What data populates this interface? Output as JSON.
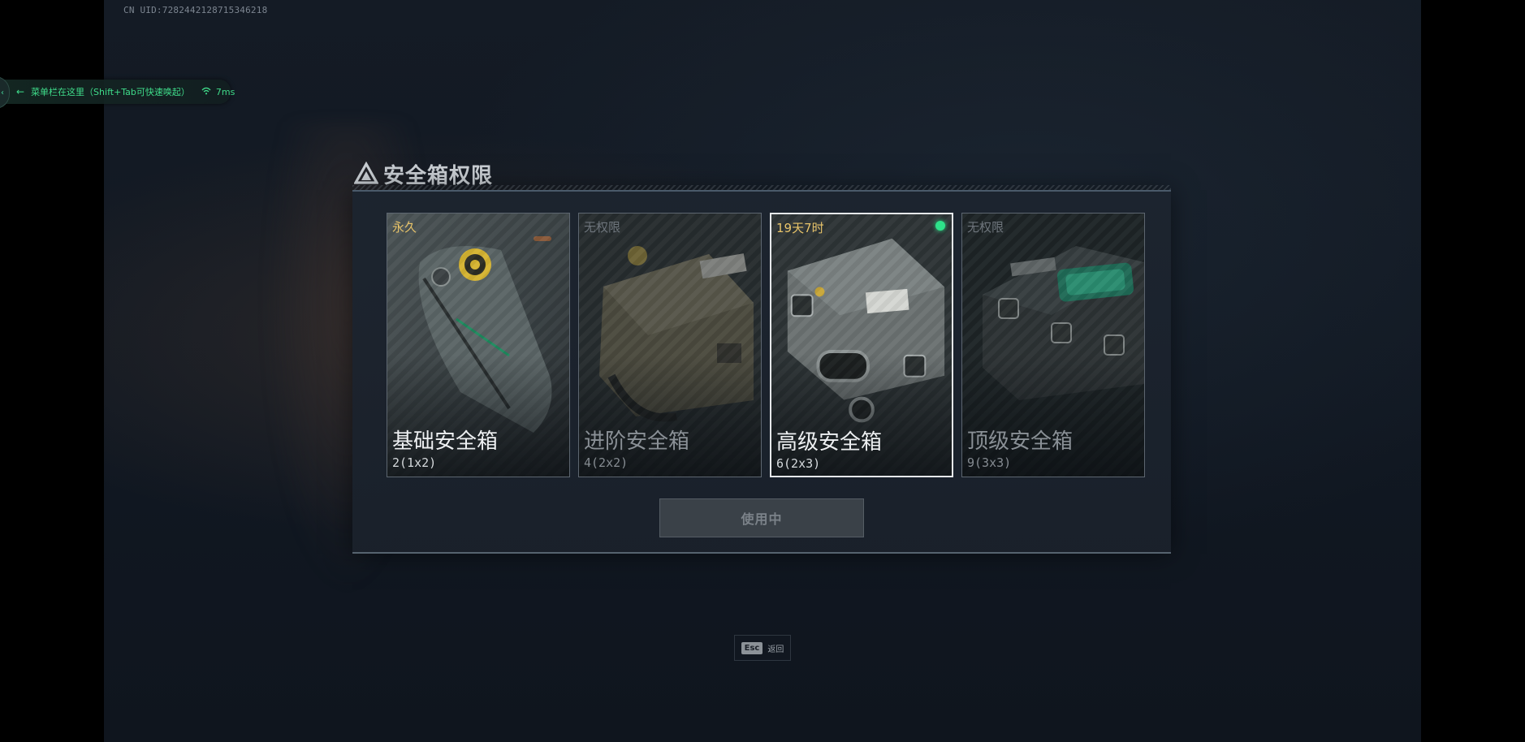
{
  "uid": "CN UID:7282442128715346218",
  "menu_hint": {
    "text": "菜单栏在这里（Shift+Tab可快速唤起）",
    "ping": "7ms",
    "arrow_icon": "arrow-left-icon",
    "signal_icon": "wifi-icon"
  },
  "dialog": {
    "title": "安全箱权限",
    "title_icon": "warning-triangle-icon",
    "cards": [
      {
        "status": "永久",
        "name": "基础安全箱",
        "capacity": "2(1x2)"
      },
      {
        "status": "无权限",
        "name": "进阶安全箱",
        "capacity": "4(2x2)"
      },
      {
        "status": "19天7时",
        "name": "高级安全箱",
        "capacity": "6(2x3)"
      },
      {
        "status": "无权限",
        "name": "顶级安全箱",
        "capacity": "9(3x3)"
      }
    ],
    "action_button": "使用中"
  },
  "footer": {
    "esc_key": "Esc",
    "esc_label": "返回"
  },
  "colors": {
    "accent_green": "#2ee28a",
    "gold_status": "#e8c46a",
    "panel_bg": "#1c242f"
  }
}
